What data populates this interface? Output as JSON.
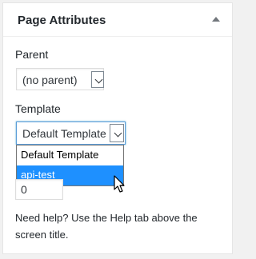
{
  "panel": {
    "title": "Page Attributes",
    "toggle_icon": "caret-up-icon"
  },
  "parent": {
    "label": "Parent",
    "selected": "(no parent)"
  },
  "template": {
    "label": "Template",
    "selected": "Default Template",
    "options": [
      "Default Template",
      "api-test"
    ],
    "highlighted_option": "api-test"
  },
  "order": {
    "value": "0"
  },
  "help": {
    "text": "Need help? Use the Help tab above the screen title."
  },
  "colors": {
    "highlight": "#1e90ff",
    "focus_border": "#5b9dd9",
    "text": "#23282d"
  },
  "cursor_icon": "mouse-pointer-icon"
}
